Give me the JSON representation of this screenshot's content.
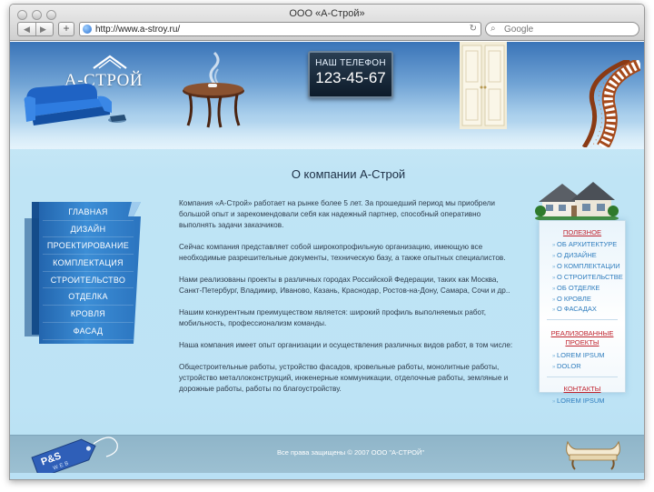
{
  "browser": {
    "window_title": "ООО «А-Строй»",
    "url": "http://www.a-stroy.ru/",
    "search_placeholder": "Google",
    "back_glyph": "◀",
    "forward_glyph": "▶",
    "add_glyph": "+",
    "reload_glyph": "↻",
    "search_glyph": "⌕"
  },
  "header": {
    "logo": "А-СТРОЙ",
    "tv_title": "НАШ ТЕЛЕФОН",
    "phone": "123-45-67"
  },
  "page_title": "О компании А-Строй",
  "menu": {
    "items": [
      {
        "label": "ГЛАВНАЯ"
      },
      {
        "label": "ДИЗАЙН"
      },
      {
        "label": "ПРОЕКТИРОВАНИЕ"
      },
      {
        "label": "КОМПЛЕКТАЦИЯ"
      },
      {
        "label": "СТРОИТЕЛЬСТВО"
      },
      {
        "label": "ОТДЕЛКА"
      },
      {
        "label": "КРОВЛЯ"
      },
      {
        "label": "ФАСАД"
      }
    ]
  },
  "content": {
    "paragraphs": [
      "Компания «А-Строй» работает на рынке более 5 лет. За прошедший период мы приобрели большой опыт и зарекомендовали себя как надежный партнер, способный оперативно выполнять задачи заказчиков.",
      "Сейчас компания представляет собой широкопрофильную организацию, имеющую все необходимые разрешительные документы, техническую базу, а также опытных специалистов.",
      "Нами реализованы проекты в различных городах Российской Федерации, таких как Москва, Санкт-Петербург, Владимир, Иваново, Казань, Краснодар, Ростов-на-Дону, Самара, Сочи и др..",
      "Нашим конкурентным преимуществом является: широкий профиль выполняемых работ, мобильность, профессионализм команды.",
      "Наша компания имеет опыт организации и осуществления различных видов работ, в том числе:",
      "Общестроительные работы, устройство фасадов, кровельные работы, монолитные работы, устройство металлоконструкций, инженерные коммуникации, отделочные работы, земляные и дорожные работы, работы по благоустройству."
    ]
  },
  "sidebar": {
    "useful_heading": "ПОЛЕЗНОЕ",
    "useful_items": [
      {
        "label": "ОБ АРХИТЕКТУРЕ"
      },
      {
        "label": "О ДИЗАЙНЕ"
      },
      {
        "label": "О КОМПЛЕКТАЦИИ"
      },
      {
        "label": "О СТРОИТЕЛЬСТВЕ"
      },
      {
        "label": "ОБ ОТДЕЛКЕ"
      },
      {
        "label": "О КРОВЛЕ"
      },
      {
        "label": "О ФАСАДАХ"
      }
    ],
    "projects_heading": "РЕАЛИЗОВАННЫЕ ПРОЕКТЫ",
    "projects_items": [
      {
        "label": "LOREM IPSUM"
      },
      {
        "label": "DOLOR"
      }
    ],
    "contacts_heading": "КОНТАКТЫ",
    "contacts_items": [
      {
        "label": "LOREM IPSUM"
      }
    ]
  },
  "footer": {
    "copyright": "Все права защищены © 2007 ООО \"А-СТРОЙ\"",
    "badge_line1": "P&S",
    "badge_line2": "WEB"
  },
  "colors": {
    "menu_blue": "#2f7dc4",
    "link_blue": "#2f7dbe",
    "heading_red": "#c0242f",
    "footer_bg": "#96bbce"
  }
}
